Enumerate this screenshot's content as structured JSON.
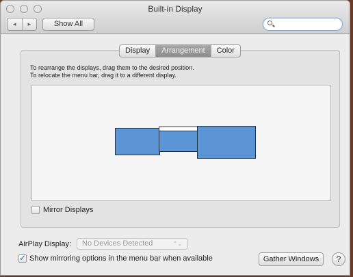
{
  "window": {
    "title": "Built-in Display",
    "back_icon": "◂",
    "forward_icon": "▸",
    "show_all_label": "Show All",
    "search_placeholder": ""
  },
  "tabs": [
    {
      "label": "Display",
      "active": false
    },
    {
      "label": "Arrangement",
      "active": true
    },
    {
      "label": "Color",
      "active": false
    }
  ],
  "instructions": {
    "line1": "To rearrange the displays, drag them to the desired position.",
    "line2": "To relocate the menu bar, drag it to a different display."
  },
  "mirror_displays": {
    "label": "Mirror Displays",
    "checked": false
  },
  "airplay": {
    "label": "AirPlay Display:",
    "selected": "No Devices Detected",
    "arrows": "⌃⌄"
  },
  "show_mirroring": {
    "label": "Show mirroring options in the menu bar when available",
    "checked": true
  },
  "buttons": {
    "gather": "Gather Windows",
    "help": "?"
  },
  "colors": {
    "display_fill": "#5b95d6",
    "active_tab": "#9b9b9b"
  }
}
